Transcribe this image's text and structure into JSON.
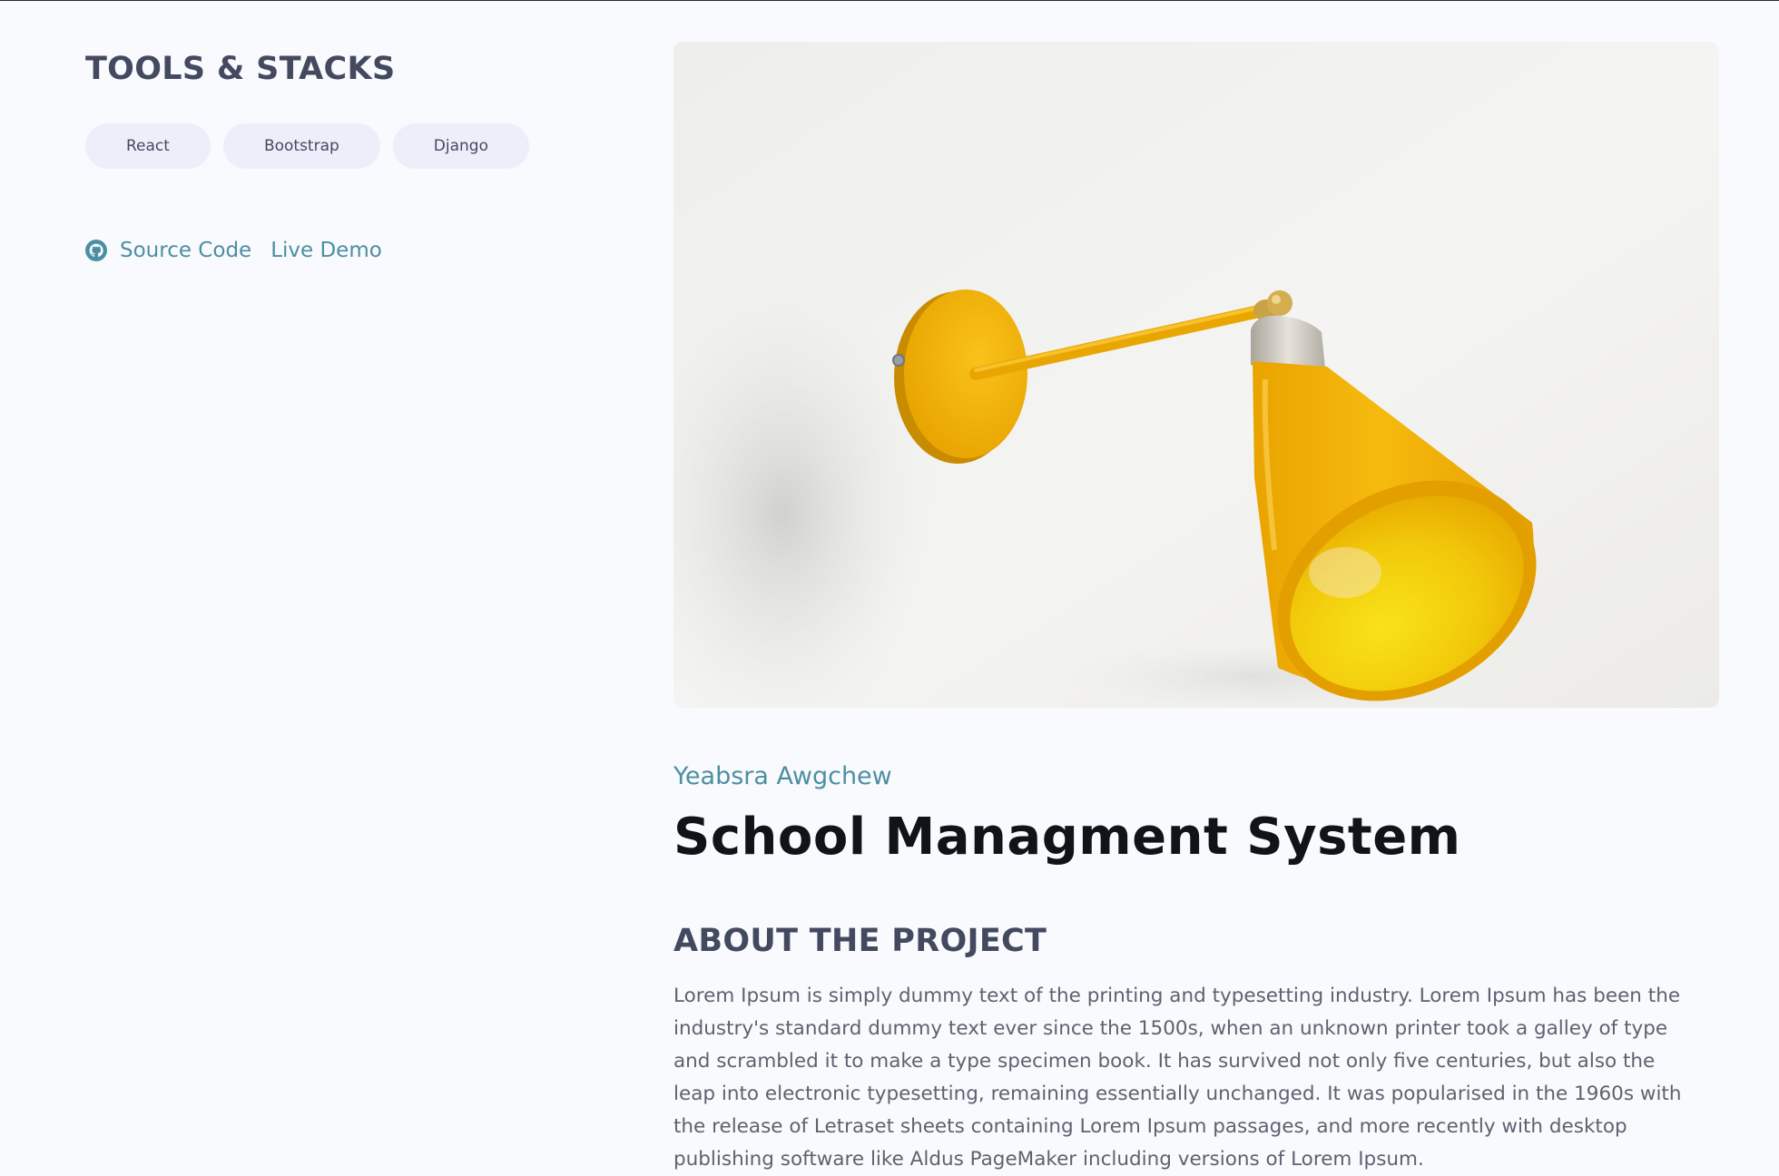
{
  "tools": {
    "heading": "TOOLS & STACKS",
    "stacks": [
      "React",
      "Bootstrap",
      "Django"
    ]
  },
  "links": {
    "source_code": "Source Code",
    "live_demo": "Live Demo",
    "source_icon": "github-icon"
  },
  "project": {
    "image_subject": "yellow wall lamp",
    "author": "Yeabsra Awgchew",
    "title": "School Managment System",
    "about_heading": "ABOUT THE PROJECT",
    "about_text": "Lorem Ipsum is simply dummy text of the printing and typesetting industry. Lorem Ipsum has been the industry's standard dummy text ever since the 1500s, when an unknown printer took a galley of type and scrambled it to make a type specimen book. It has survived not only five centuries, but also the leap into electronic typesetting, remaining essentially unchanged. It was popularised in the 1960s with the release of Letraset sheets containing Lorem Ipsum passages, and more recently with desktop publishing software like Aldus PageMaker including versions of Lorem Ipsum."
  },
  "colors": {
    "background": "#f9fafd",
    "accent": "#4c8fa3",
    "heading": "#434a60",
    "title": "#111318",
    "pill": "#eeeefb",
    "lamp": "#f2b100"
  }
}
